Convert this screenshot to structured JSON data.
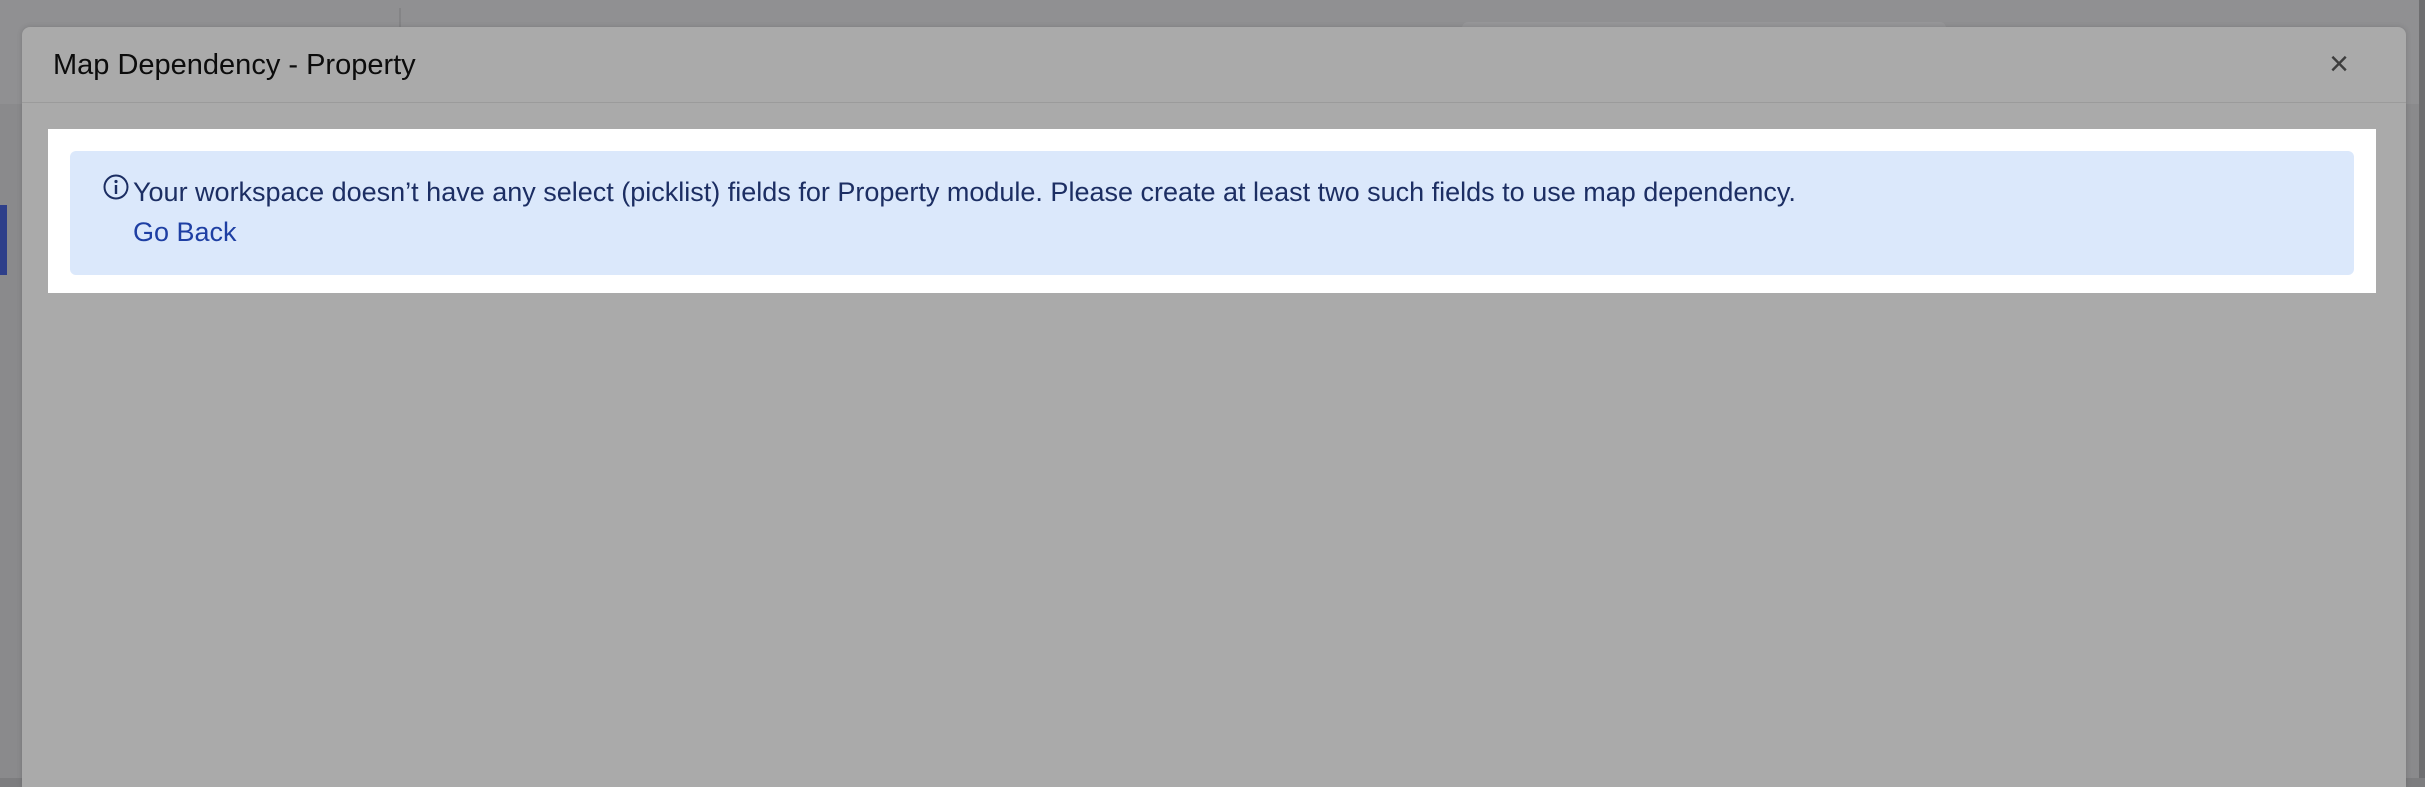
{
  "modal": {
    "title": "Map Dependency - Property",
    "close_label": "×"
  },
  "alert": {
    "icon": "info-icon",
    "message": "Your workspace doesn’t have any select (picklist) fields for Property module. Please create at least two such fields to use map dependency.",
    "link_label": "Go Back"
  },
  "colors": {
    "overlay": "#aaaaaa",
    "alert_background": "#dbe8fb",
    "alert_text": "#1c2e63",
    "link": "#1e3fa3"
  }
}
